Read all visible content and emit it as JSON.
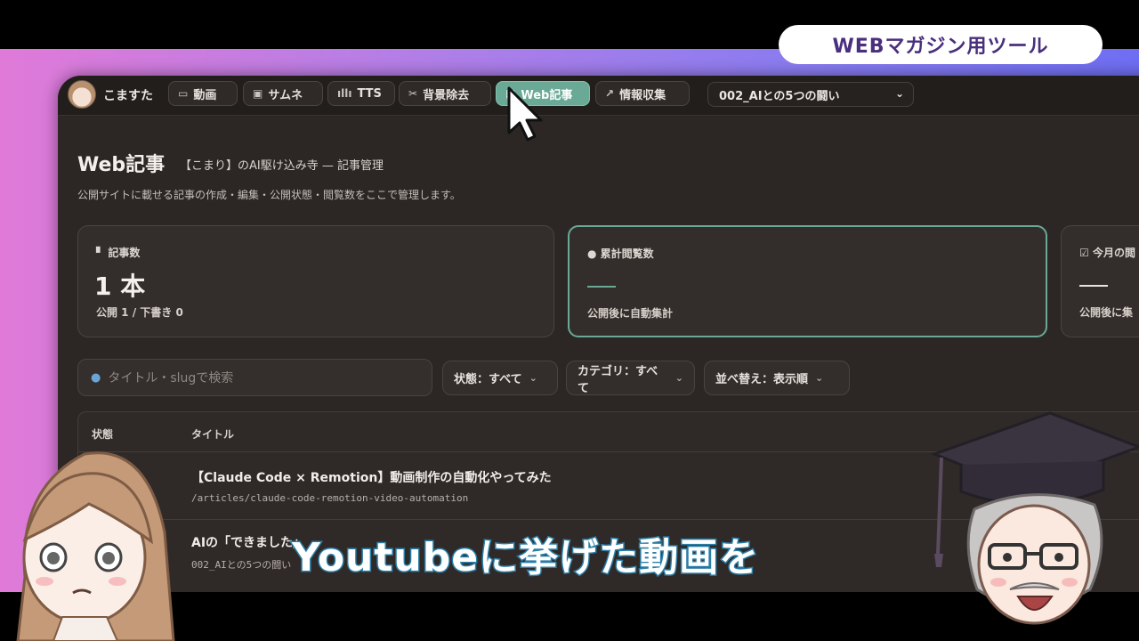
{
  "overlay": {
    "badge": "WEBマガジン用ツール",
    "caption": "Youtubeに挙げた動画を"
  },
  "header": {
    "user_name": "こますた",
    "tabs": [
      {
        "label": "動画",
        "icon": "clapper-icon"
      },
      {
        "label": "サムネ",
        "icon": "image-icon"
      },
      {
        "label": "TTS",
        "icon": "waveform-icon"
      },
      {
        "label": "背景除去",
        "icon": "scissors-icon"
      },
      {
        "label": "Web記事",
        "icon": "document-icon",
        "active": true
      },
      {
        "label": "情報収集",
        "icon": "trend-icon"
      }
    ],
    "project_select": "002_AIとの5つの闘い"
  },
  "page": {
    "title": "Web記事",
    "subtitle": "【こまり】のAI駆け込み寺 — 記事管理",
    "description": "公開サイトに載せる記事の作成・編集・公開状態・閲覧数をここで管理します。"
  },
  "cards": [
    {
      "label": "記事数",
      "value": "1 本",
      "sub": "公開 1 / 下書き 0"
    },
    {
      "label": "累計閲覧数",
      "value": "—",
      "sub": "公開後に自動集計"
    },
    {
      "label": "今月の閲",
      "value": "—",
      "sub": "公開後に集"
    }
  ],
  "toolbar": {
    "search_placeholder": "タイトル・slugで検索",
    "filters": [
      "状態：すべて",
      "カテゴリ：すべて",
      "並べ替え：表示順"
    ]
  },
  "table": {
    "headers": [
      "状態",
      "タイトル"
    ],
    "rows": [
      {
        "title": "【Claude Code × Remotion】動画制作の自動化やってみた",
        "slug": "/articles/claude-code-remotion-video-automation"
      },
      {
        "title": "AIの「できました」",
        "slug": "002_AIとの5つの闘い"
      }
    ]
  },
  "colors": {
    "accent": "#6aa996",
    "window_bg": "#2c2725",
    "badge_text": "#4a2f7d",
    "caption_stroke": "#2b7ea6"
  }
}
